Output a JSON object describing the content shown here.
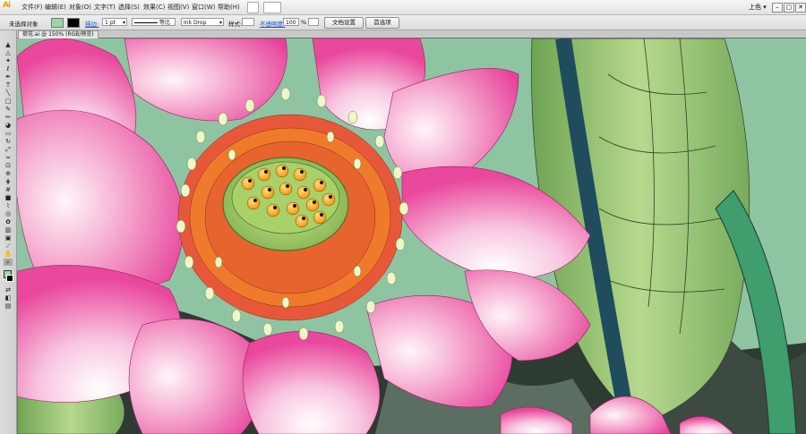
{
  "app": {
    "logo_text": "Ai"
  },
  "menu": [
    "文件(F)",
    "编辑(E)",
    "对象(O)",
    "文字(T)",
    "选择(S)",
    "效果(C)",
    "视图(V)",
    "窗口(W)",
    "帮助(H)"
  ],
  "workspace": {
    "label": "上色 ▾"
  },
  "window_controls": [
    "–",
    "▢",
    "✕"
  ],
  "control_bar": {
    "selection_status": "未选择对象",
    "stroke_label": "描边:",
    "stroke_weight": "1 pt",
    "stroke_profile": "等比",
    "brush": "Ink Drop",
    "style_label": "样式:",
    "opacity_label": "不透明度:",
    "opacity_value": "100",
    "opacity_unit": "%",
    "doc_setup_button": "文档设置",
    "preferences_button": "首选项"
  },
  "document": {
    "tab_title": "荷花.ai @ 150% (RGB/预览)"
  },
  "colors": {
    "fill": "#9fd4a3",
    "stroke": "#000000",
    "canvas_bg": "#8fc4a3"
  },
  "tools": [
    "selection-tool",
    "direct-selection-tool",
    "magic-wand-tool",
    "lasso-tool",
    "pen-tool",
    "type-tool",
    "line-tool",
    "rectangle-tool",
    "paintbrush-tool",
    "pencil-tool",
    "blob-brush-tool",
    "eraser-tool",
    "rotate-tool",
    "scale-tool",
    "width-tool",
    "free-transform-tool",
    "shape-builder-tool",
    "perspective-grid-tool",
    "mesh-tool",
    "gradient-tool",
    "eyedropper-tool",
    "blend-tool",
    "symbol-sprayer-tool",
    "column-graph-tool",
    "artboard-tool",
    "slice-tool",
    "hand-tool",
    "zoom-tool",
    "fill-stroke-swatch",
    "swap-colors",
    "color-mode",
    "screen-mode"
  ]
}
